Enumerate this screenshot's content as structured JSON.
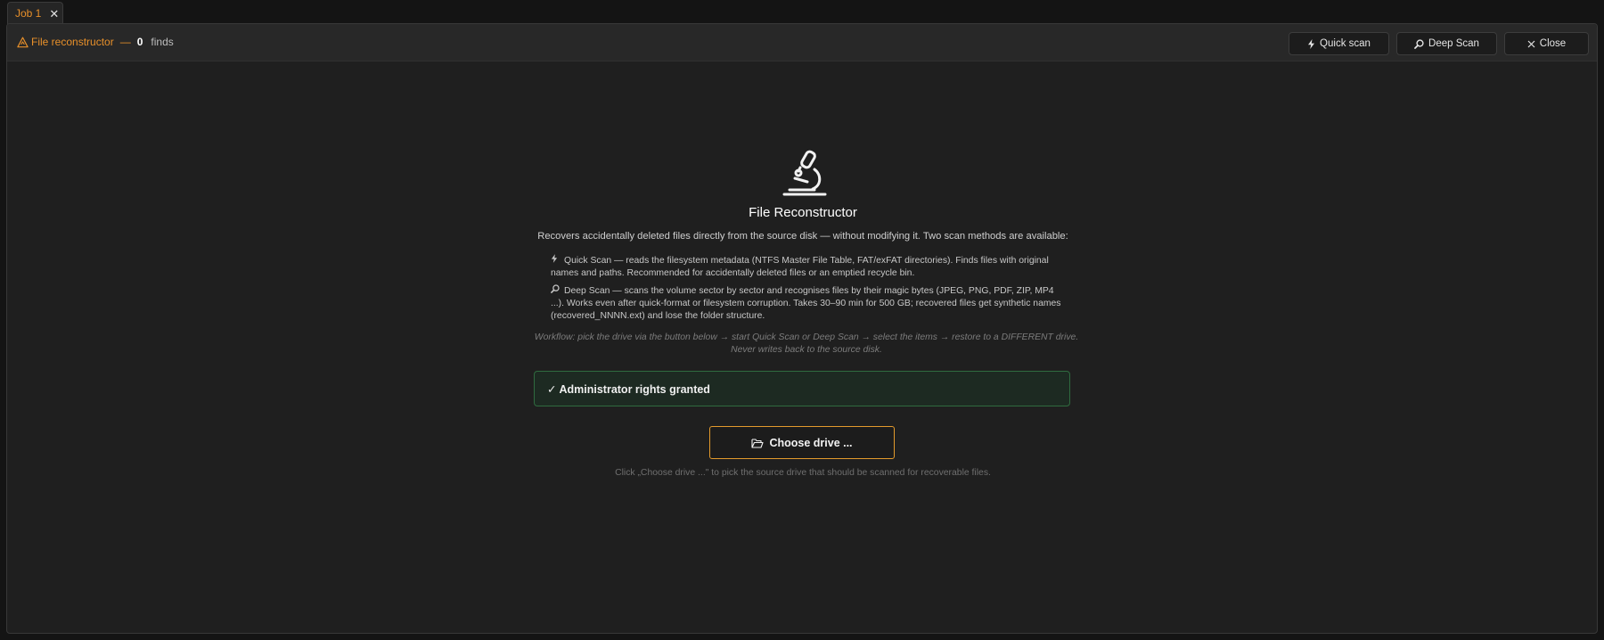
{
  "tabs": [
    {
      "label": "Job 1",
      "close": "✕"
    }
  ],
  "toolbar": {
    "module_name": "File reconstructor",
    "separator": "—",
    "finds_count": "0",
    "finds_label": "finds",
    "quick_scan_label": "Quick scan",
    "deep_scan_label": "Deep Scan",
    "close_label": "Close"
  },
  "main": {
    "title": "File Reconstructor",
    "intro": "Recovers accidentally deleted files directly from the source disk — without modifying it. Two scan methods are available:",
    "quick_scan_desc": "Quick Scan — reads the filesystem metadata (NTFS Master File Table, FAT/exFAT directories). Finds files with original names and paths. Recommended for accidentally deleted files or an emptied recycle bin.",
    "deep_scan_desc": "Deep Scan — scans the volume sector by sector and recognises files by their magic bytes (JPEG, PNG, PDF, ZIP, MP4 ...). Works even after quick-format or filesystem corruption. Takes 30–90 min for 500 GB; recovered files get synthetic names (recovered_NNNN.ext) and lose the folder structure.",
    "workflow": "Workflow: pick the drive via the button below → start Quick Scan or Deep Scan → select the items → restore to a DIFFERENT drive. Never writes back to the source disk.",
    "admin_status": "✓ Administrator rights granted",
    "choose_drive_label": "Choose drive ...",
    "hint": "Click „Choose drive ...\" to pick the source drive that should be scanned for recoverable files."
  },
  "icons": {
    "tab_close": "close-icon",
    "module": "warning-icon",
    "quick": "lightning-icon",
    "deep": "magnifier-icon",
    "close": "close-icon",
    "hero": "microscope-icon",
    "choose": "folder-open-icon"
  },
  "colors": {
    "accent": "#e8902a",
    "success_border": "#2f6b3f",
    "success_bg": "#1d2a22",
    "background": "#1f1f1f"
  }
}
